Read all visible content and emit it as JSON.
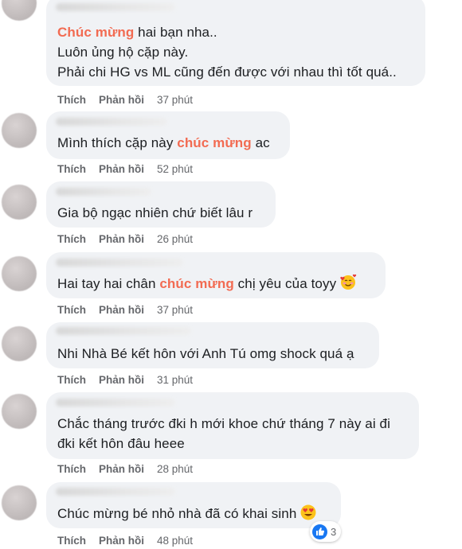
{
  "actions": {
    "like": "Thích",
    "reply": "Phản hồi"
  },
  "comments": [
    {
      "lines": [
        {
          "highlight": "Chúc mừng",
          "text": " hai bạn nha.."
        },
        {
          "text": "Luôn ủng hộ cặp này."
        },
        {
          "text": "Phải chi HG vs ML cũng đến được với nhau thì tốt quá.."
        }
      ],
      "time": "37 phút"
    },
    {
      "lines": [
        {
          "text": "Mình thích cặp này ",
          "highlight": "chúc mừng",
          "after": " ac"
        }
      ],
      "time": "52 phút"
    },
    {
      "lines": [
        {
          "text": "Gia bộ ngạc nhiên chứ biết lâu r"
        }
      ],
      "time": "26 phút"
    },
    {
      "lines": [
        {
          "text": "Hai tay hai chân ",
          "highlight": "chúc mừng",
          "after": " chị yêu của toyy"
        }
      ],
      "emoji": "smiling-face-with-hearts",
      "time": "37 phút"
    },
    {
      "lines": [
        {
          "text": "Nhi Nhà Bé kết hôn với Anh Tú omg shock quá ạ"
        }
      ],
      "time": "31 phút"
    },
    {
      "lines": [
        {
          "text": "Chắc tháng trước đki h mới khoe chứ tháng 7 này ai đi"
        },
        {
          "text": "đki kết hôn đâu heee"
        }
      ],
      "time": "28 phút"
    },
    {
      "lines": [
        {
          "text": "Chúc mừng bé nhỏ nhà đã có khai sinh"
        }
      ],
      "emoji": "heart-eyes",
      "time": "48 phút",
      "reaction_count": "3"
    }
  ],
  "colors": {
    "highlight": "#f26b52",
    "bubble": "#f0f2f5",
    "meta": "#65676b",
    "like_blue": "#1877f2"
  }
}
